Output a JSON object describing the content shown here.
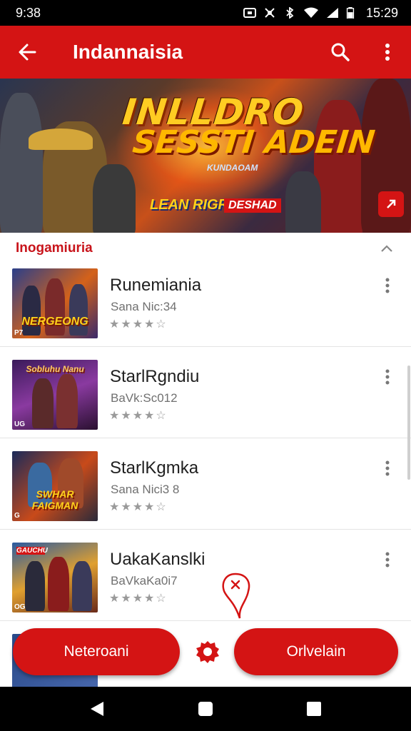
{
  "status_bar": {
    "time_left": "9:38",
    "time_right": "15:29"
  },
  "app_bar": {
    "title": "Indannaisia",
    "icons": [
      "back-arrow-icon",
      "search-icon",
      "overflow-menu-icon"
    ]
  },
  "banner": {
    "logo_line1": "INLLDRO",
    "logo_line2": "SESSTI ADEIN",
    "sub_tag": "KUNDAOAM",
    "tag_yellow": "LEAN RIGRA",
    "tag_red": "DESHAD",
    "next_icon": "chevron-right-icon"
  },
  "section": {
    "title": "Inogamiuria",
    "collapse_icon": "chevron-up-icon"
  },
  "games": [
    {
      "name": "Runemiania",
      "subtitle": "Sana Nic:34",
      "thumb_text": "NERGEONG",
      "corner": "P7"
    },
    {
      "name": "StarlRgndiu",
      "subtitle": "BaVk:Sc012",
      "thumb_text": "Sobluhu Nanu",
      "corner": "UG"
    },
    {
      "name": "StarlKgmka",
      "subtitle": "Sana Nici3 8",
      "thumb_text": "SWHAR FAIGMAN",
      "corner": "G"
    },
    {
      "name": "UakaKanslki",
      "subtitle": "BaVkaKa0i7",
      "thumb_text": "GAUCHU",
      "corner": "OG"
    }
  ],
  "rating_glyphs": "★★★★☆",
  "bottom_actions": {
    "left_label": "Neteroani",
    "right_label": "Orlvelain",
    "middle_icon": "gear-icon"
  },
  "nav_bar": {
    "icons": [
      "back-triangle-icon",
      "home-square-icon",
      "recents-square-icon"
    ]
  },
  "colors": {
    "primary_red": "#d41414",
    "section_red": "#c8141b"
  }
}
